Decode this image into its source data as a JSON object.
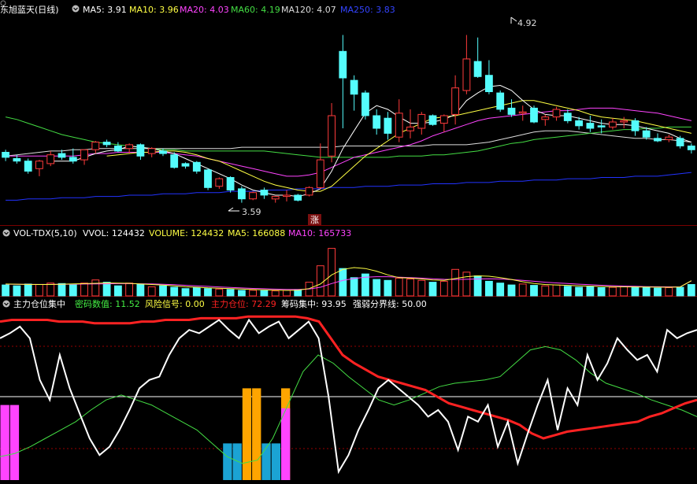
{
  "colors": {
    "background": "#000000",
    "up": "#ff3b3b",
    "down": "#54fcfc",
    "white": "#ffffff",
    "ma5": "#ffffff",
    "ma10": "#ffff44",
    "ma20": "#ff44ff",
    "ma60": "#44dd44",
    "ma120": "#dddddd",
    "ma250": "#2233ff",
    "panel_border": "#7a0000",
    "dotted": "#990000",
    "limit_up_bg": "#7a1010",
    "green_text": "#44ee44",
    "yellow": "#ffff44",
    "magenta": "#ff44ff",
    "red": "#ff2222",
    "orange": "#ffa500",
    "teal": "#1ba3d4"
  },
  "header": {
    "title": "东旭蓝天(日线)",
    "ma5": "MA5: 3.91",
    "ma10": "MA10: 3.96",
    "ma20": "MA20: 4.03",
    "ma60": "MA60: 4.19",
    "ma120": "MA120: 4.07",
    "ma250": "MA250: 3.83"
  },
  "vol_header": {
    "title": "VOL-TDX(5,10)",
    "vvol": "VVOL: 124432",
    "volume": "VOLUME: 124432",
    "ma5": "MA5: 166088",
    "ma10": "MA10: 165733"
  },
  "ind_header": {
    "title": "主力仓位集中",
    "chips_value": "密码数值: 11.52",
    "risk_signal": "风险信号: 0.00",
    "main_position": "主力仓位: 72.29",
    "chip_concentration": "筹码集中: 93.95",
    "divider": "强弱分界线: 50.00"
  },
  "annotations": {
    "high": "4.92",
    "low": "3.59",
    "limit_up": "涨"
  },
  "chart_data": [
    {
      "type": "candlestick",
      "title": "东旭蓝天(日线)",
      "ylim": [
        3.45,
        5.06
      ],
      "annotations": [
        {
          "label": "4.92",
          "index": 41,
          "price": 4.92
        },
        {
          "label": "3.59",
          "index": 18,
          "price": 3.59
        },
        {
          "label": "涨",
          "index": 24
        }
      ],
      "ohlc": [
        [
          3.99,
          4.01,
          3.92,
          3.95
        ],
        [
          3.94,
          3.97,
          3.9,
          3.92
        ],
        [
          3.92,
          3.94,
          3.82,
          3.84
        ],
        [
          3.86,
          3.93,
          3.8,
          3.92
        ],
        [
          3.9,
          4.0,
          3.88,
          3.97
        ],
        [
          3.98,
          4.01,
          3.93,
          3.95
        ],
        [
          3.95,
          4.02,
          3.9,
          3.92
        ],
        [
          3.93,
          4.0,
          3.89,
          4.01
        ],
        [
          4.01,
          4.08,
          3.98,
          4.07
        ],
        [
          4.07,
          4.09,
          4.03,
          4.05
        ],
        [
          4.04,
          4.07,
          3.99,
          4.0
        ],
        [
          4.02,
          4.06,
          3.98,
          4.05
        ],
        [
          4.05,
          4.06,
          3.93,
          3.96
        ],
        [
          3.98,
          4.03,
          3.95,
          4.02
        ],
        [
          4.0,
          4.02,
          3.96,
          3.98
        ],
        [
          3.97,
          3.99,
          3.86,
          3.87
        ],
        [
          3.9,
          3.91,
          3.86,
          3.88
        ],
        [
          3.91,
          3.92,
          3.82,
          3.84
        ],
        [
          3.85,
          3.86,
          3.69,
          3.71
        ],
        [
          3.72,
          3.79,
          3.7,
          3.78
        ],
        [
          3.79,
          3.8,
          3.67,
          3.69
        ],
        [
          3.7,
          3.72,
          3.59,
          3.62
        ],
        [
          3.62,
          3.68,
          3.61,
          3.67
        ],
        [
          3.69,
          3.71,
          3.62,
          3.65
        ],
        [
          3.62,
          3.64,
          3.59,
          3.64
        ],
        [
          3.64,
          3.69,
          3.6,
          3.65
        ],
        [
          3.65,
          3.66,
          3.6,
          3.61
        ],
        [
          3.65,
          3.72,
          3.64,
          3.71
        ],
        [
          3.71,
          4.06,
          3.7,
          3.93
        ],
        [
          3.96,
          4.38,
          3.91,
          4.28
        ],
        [
          4.79,
          4.92,
          4.18,
          4.58
        ],
        [
          4.56,
          4.6,
          4.32,
          4.45
        ],
        [
          4.46,
          4.48,
          4.25,
          4.28
        ],
        [
          4.28,
          4.33,
          4.13,
          4.18
        ],
        [
          4.26,
          4.31,
          4.09,
          4.14
        ],
        [
          4.11,
          4.41,
          4.07,
          4.3
        ],
        [
          4.16,
          4.33,
          4.1,
          4.19
        ],
        [
          4.18,
          4.31,
          4.13,
          4.29
        ],
        [
          4.28,
          4.29,
          4.2,
          4.21
        ],
        [
          4.22,
          4.29,
          4.15,
          4.28
        ],
        [
          4.29,
          4.6,
          4.21,
          4.5
        ],
        [
          4.48,
          4.92,
          4.45,
          4.73
        ],
        [
          4.71,
          4.9,
          4.58,
          4.59
        ],
        [
          4.6,
          4.72,
          4.45,
          4.47
        ],
        [
          4.46,
          4.48,
          4.31,
          4.33
        ],
        [
          4.34,
          4.41,
          4.27,
          4.29
        ],
        [
          4.3,
          4.36,
          4.24,
          4.31
        ],
        [
          4.34,
          4.36,
          4.22,
          4.23
        ],
        [
          4.25,
          4.29,
          4.2,
          4.27
        ],
        [
          4.27,
          4.35,
          4.24,
          4.33
        ],
        [
          4.3,
          4.33,
          4.22,
          4.24
        ],
        [
          4.24,
          4.27,
          4.17,
          4.2
        ],
        [
          4.22,
          4.28,
          4.15,
          4.18
        ],
        [
          4.2,
          4.25,
          4.14,
          4.19
        ],
        [
          4.19,
          4.26,
          4.17,
          4.23
        ],
        [
          4.23,
          4.27,
          4.18,
          4.24
        ],
        [
          4.24,
          4.26,
          4.12,
          4.16
        ],
        [
          4.16,
          4.19,
          4.09,
          4.11
        ],
        [
          4.1,
          4.14,
          4.07,
          4.08
        ],
        [
          4.09,
          4.13,
          4.07,
          4.11
        ],
        [
          4.1,
          4.12,
          4.02,
          4.04
        ],
        [
          4.04,
          4.06,
          3.98,
          4.01
        ]
      ],
      "ma5": [
        null,
        null,
        null,
        null,
        3.92,
        3.92,
        3.92,
        3.95,
        3.98,
        4.0,
        4.01,
        4.04,
        4.03,
        4.02,
        4.0,
        3.98,
        3.94,
        3.9,
        3.86,
        3.82,
        3.78,
        3.73,
        3.69,
        3.67,
        3.65,
        3.65,
        3.64,
        3.66,
        3.7,
        3.84,
        4.02,
        4.16,
        4.3,
        4.36,
        4.33,
        4.27,
        4.22,
        4.22,
        4.23,
        4.25,
        4.29,
        4.4,
        4.46,
        4.51,
        4.52,
        4.48,
        4.4,
        4.33,
        4.29,
        4.28,
        4.28,
        4.26,
        4.24,
        4.22,
        4.21,
        4.21,
        4.2,
        4.18,
        4.16,
        4.14,
        4.1,
        4.07
      ],
      "ma10": [
        null,
        null,
        null,
        null,
        null,
        null,
        null,
        null,
        null,
        3.96,
        3.97,
        3.98,
        3.99,
        3.99,
        4.0,
        4.0,
        3.99,
        3.97,
        3.94,
        3.92,
        3.88,
        3.84,
        3.8,
        3.76,
        3.73,
        3.71,
        3.69,
        3.68,
        3.68,
        3.72,
        3.8,
        3.88,
        3.96,
        4.02,
        4.08,
        4.14,
        4.18,
        4.22,
        4.26,
        4.27,
        4.28,
        4.3,
        4.32,
        4.34,
        4.36,
        4.38,
        4.4,
        4.4,
        4.38,
        4.36,
        4.34,
        4.32,
        4.29,
        4.27,
        4.26,
        4.25,
        4.24,
        4.22,
        4.2,
        4.18,
        4.16,
        4.14
      ],
      "ma20": [
        3.96,
        3.96,
        3.96,
        3.96,
        3.96,
        3.96,
        3.96,
        3.97,
        3.98,
        3.98,
        3.99,
        3.99,
        3.99,
        3.99,
        3.99,
        3.98,
        3.97,
        3.96,
        3.94,
        3.92,
        3.9,
        3.88,
        3.86,
        3.84,
        3.82,
        3.8,
        3.8,
        3.81,
        3.83,
        3.87,
        3.91,
        3.95,
        3.97,
        3.99,
        4.01,
        4.03,
        4.05,
        4.08,
        4.12,
        4.15,
        4.18,
        4.21,
        4.24,
        4.26,
        4.27,
        4.28,
        4.29,
        4.3,
        4.31,
        4.32,
        4.32,
        4.33,
        4.34,
        4.34,
        4.34,
        4.33,
        4.32,
        4.31,
        4.3,
        4.28,
        4.26,
        4.24
      ],
      "ma60": [
        4.27,
        4.25,
        4.22,
        4.19,
        4.16,
        4.13,
        4.11,
        4.09,
        4.07,
        4.06,
        4.05,
        4.04,
        4.03,
        4.02,
        4.01,
        4.01,
        4.0,
        4.0,
        4.0,
        4.0,
        4.0,
        4.0,
        4.0,
        4.0,
        3.99,
        3.98,
        3.97,
        3.96,
        3.95,
        3.95,
        3.95,
        3.95,
        3.95,
        3.95,
        3.95,
        3.96,
        3.96,
        3.96,
        3.97,
        3.97,
        3.98,
        3.99,
        4.0,
        4.02,
        4.04,
        4.06,
        4.07,
        4.09,
        4.1,
        4.11,
        4.12,
        4.13,
        4.14,
        4.15,
        4.16,
        4.17,
        4.17,
        4.18,
        4.18,
        4.19,
        4.19,
        4.19
      ],
      "ma120": [
        3.96,
        3.97,
        3.98,
        3.99,
        4.0,
        4.0,
        4.01,
        4.01,
        4.02,
        4.02,
        4.02,
        4.02,
        4.02,
        4.02,
        4.02,
        4.02,
        4.02,
        4.02,
        4.02,
        4.02,
        4.02,
        4.03,
        4.03,
        4.03,
        4.03,
        4.03,
        4.03,
        4.03,
        4.03,
        4.03,
        4.04,
        4.04,
        4.04,
        4.04,
        4.04,
        4.04,
        4.04,
        4.04,
        4.05,
        4.05,
        4.05,
        4.05,
        4.06,
        4.07,
        4.09,
        4.11,
        4.13,
        4.15,
        4.16,
        4.16,
        4.16,
        4.15,
        4.14,
        4.13,
        4.12,
        4.11,
        4.1,
        4.1,
        4.09,
        4.09,
        4.08,
        4.07
      ],
      "ma250": [
        3.61,
        3.61,
        3.62,
        3.62,
        3.62,
        3.63,
        3.63,
        3.63,
        3.64,
        3.64,
        3.64,
        3.65,
        3.65,
        3.65,
        3.66,
        3.66,
        3.66,
        3.67,
        3.67,
        3.67,
        3.68,
        3.68,
        3.68,
        3.69,
        3.69,
        3.69,
        3.7,
        3.7,
        3.7,
        3.71,
        3.71,
        3.71,
        3.72,
        3.72,
        3.72,
        3.73,
        3.73,
        3.73,
        3.74,
        3.74,
        3.74,
        3.75,
        3.75,
        3.75,
        3.76,
        3.76,
        3.76,
        3.77,
        3.77,
        3.77,
        3.78,
        3.78,
        3.78,
        3.79,
        3.79,
        3.79,
        3.8,
        3.8,
        3.8,
        3.81,
        3.82,
        3.83
      ]
    },
    {
      "type": "bar",
      "title": "VOL-TDX(5,10)",
      "ylim": [
        0,
        620000
      ],
      "volume": [
        120000,
        110000,
        130000,
        125000,
        140000,
        135000,
        120000,
        140000,
        175000,
        150000,
        110000,
        140000,
        130000,
        100000,
        110000,
        95000,
        80000,
        90000,
        80000,
        75000,
        70000,
        60000,
        62000,
        58000,
        55000,
        60000,
        70000,
        150000,
        330000,
        520000,
        300000,
        200000,
        240000,
        180000,
        170000,
        195000,
        185000,
        170000,
        150000,
        160000,
        290000,
        260000,
        220000,
        160000,
        140000,
        120000,
        130000,
        115000,
        110000,
        120000,
        105000,
        95000,
        100000,
        90000,
        95000,
        105000,
        100000,
        90000,
        85000,
        90000,
        95000,
        124432
      ],
      "ma5": [
        130000,
        128000,
        126000,
        125000,
        125000,
        128000,
        132000,
        134000,
        138000,
        142000,
        140000,
        138000,
        130000,
        125000,
        118000,
        110000,
        100000,
        95000,
        88000,
        84000,
        80000,
        75000,
        70000,
        66000,
        62000,
        60000,
        62000,
        80000,
        130000,
        230000,
        290000,
        310000,
        300000,
        270000,
        230000,
        200000,
        195000,
        185000,
        175000,
        170000,
        190000,
        210000,
        220000,
        215000,
        200000,
        180000,
        155000,
        135000,
        125000,
        120000,
        115000,
        110000,
        108000,
        103000,
        100000,
        99000,
        98000,
        97000,
        96000,
        95000,
        98000,
        166088
      ],
      "ma10": [
        128000,
        127000,
        126000,
        126000,
        126000,
        127000,
        128000,
        130000,
        131000,
        133000,
        134000,
        134000,
        133000,
        131000,
        127000,
        122000,
        116000,
        110000,
        104000,
        98000,
        93000,
        87000,
        82000,
        78000,
        74000,
        71000,
        70000,
        75000,
        95000,
        135000,
        170000,
        190000,
        205000,
        210000,
        210000,
        205000,
        200000,
        195000,
        188000,
        182000,
        180000,
        182000,
        186000,
        188000,
        185000,
        178000,
        170000,
        160000,
        150000,
        142000,
        135000,
        128000,
        122000,
        116000,
        112000,
        108000,
        105000,
        102000,
        100000,
        99000,
        98000,
        165733
      ]
    },
    {
      "type": "line",
      "title": "主力仓位集中",
      "ylim": [
        0,
        100
      ],
      "divider": 50,
      "white_line": [
        85,
        88,
        92,
        85,
        60,
        48,
        75,
        55,
        40,
        25,
        15,
        20,
        30,
        42,
        55,
        60,
        62,
        75,
        85,
        90,
        88,
        92,
        96,
        90,
        85,
        96,
        88,
        92,
        95,
        85,
        90,
        95,
        85,
        50,
        5,
        15,
        30,
        42,
        55,
        60,
        55,
        50,
        45,
        38,
        42,
        35,
        18,
        38,
        35,
        45,
        20,
        35,
        10,
        28,
        45,
        60,
        30,
        55,
        45,
        75,
        60,
        70,
        85,
        78,
        72,
        75,
        65,
        90,
        85,
        88,
        90
      ],
      "red_line": [
        95,
        96,
        96,
        96,
        96,
        95,
        95,
        95,
        94,
        94,
        94,
        94,
        95,
        95,
        96,
        96,
        96,
        97,
        97,
        97,
        97,
        98,
        98,
        98,
        98,
        98,
        97,
        95,
        85,
        75,
        70,
        66,
        62,
        60,
        58,
        56,
        54,
        50,
        46,
        44,
        42,
        40,
        38,
        36,
        33,
        28,
        25,
        27,
        29,
        30,
        31,
        32,
        33,
        34,
        35,
        38,
        40,
        43,
        46,
        48
      ],
      "green_line": [
        14,
        16,
        20,
        25,
        30,
        35,
        42,
        48,
        51,
        48,
        45,
        40,
        35,
        30,
        22,
        14,
        10,
        12,
        25,
        45,
        65,
        75,
        70,
        62,
        55,
        48,
        45,
        48,
        52,
        56,
        58,
        59,
        60,
        62,
        70,
        78,
        80,
        78,
        72,
        64,
        58,
        55,
        52,
        48,
        45,
        42,
        38
      ],
      "magenta_bars": [
        {
          "index": 0,
          "value": 45
        },
        {
          "index": 1,
          "value": 45
        },
        {
          "index": 29,
          "value": 43
        }
      ],
      "teal_bars": [
        {
          "index": 23,
          "value": 22
        },
        {
          "index": 24,
          "value": 22
        },
        {
          "index": 27,
          "value": 22
        },
        {
          "index": 28,
          "value": 22
        }
      ],
      "orange_bars": [
        {
          "index": 25,
          "value": 55
        },
        {
          "index": 26,
          "value": 55
        },
        {
          "index": 29,
          "value": 55
        }
      ]
    }
  ]
}
